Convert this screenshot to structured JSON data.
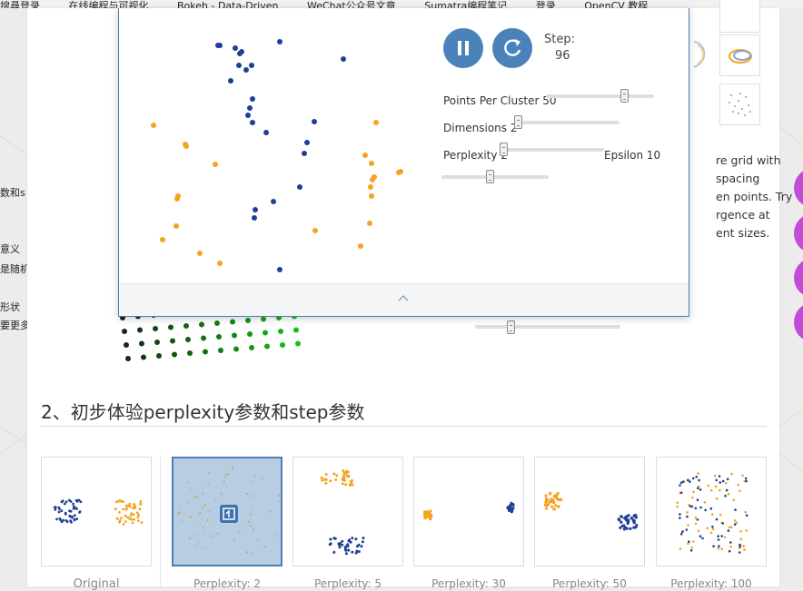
{
  "bookmarks": [
    "搜尋登录",
    "在线编程与可视化",
    "Bokeh - Data-Driven",
    "WeChat公众号文章",
    "Sumatra编程笔记",
    "登录",
    "OpenCV 教程"
  ],
  "left_fragments": [
    "数和s",
    "意义",
    "是随机",
    "形状",
    "要更多"
  ],
  "right_text_lines": [
    "re grid with",
    "spacing",
    "en points. Try",
    "rgence at",
    "ent sizes."
  ],
  "controls": {
    "pause_icon": "pause-icon",
    "restart_icon": "restart-icon",
    "step_label": "Step:",
    "step_value": "96",
    "points_per_cluster_label": "Points Per Cluster 50",
    "dimensions_label": "Dimensions 2",
    "perplexity_label": "Perplexity 2",
    "epsilon_label": "Epsilon 10",
    "points_per_cluster_value": 0.48,
    "dimensions_value": 0.0,
    "perplexity_value": 0.0,
    "epsilon_value": 0.45,
    "bottom_slider_value": 0.23
  },
  "section": {
    "heading": "2、初步体验perplexity参数和step参数"
  },
  "thumbnails": [
    {
      "caption": "Original"
    },
    {
      "caption": "Perplexity: 2"
    },
    {
      "caption": "Perplexity: 5"
    },
    {
      "caption": "Perplexity: 30"
    },
    {
      "caption": "Perplexity: 50"
    },
    {
      "caption": "Perplexity: 100"
    }
  ],
  "colors": {
    "blue": "#1f3f96",
    "orange": "#f5a320",
    "accent": "#4b82b9",
    "magenta": "#c24bd7"
  }
}
